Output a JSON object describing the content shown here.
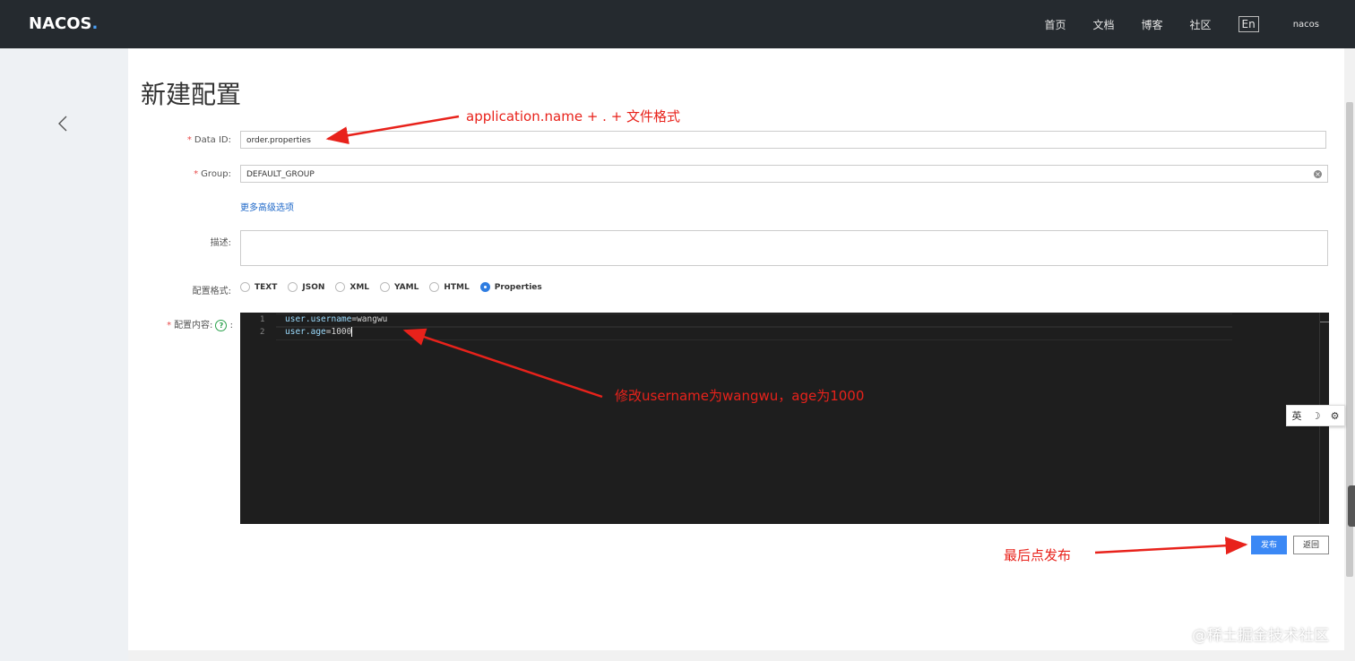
{
  "brand": {
    "name_left": "NA",
    "name_mid": "C",
    "name_right": "OS",
    "dot": "."
  },
  "nav": {
    "items": [
      "首页",
      "文档",
      "博客",
      "社区"
    ],
    "lang": "En",
    "user": "nacos"
  },
  "page": {
    "title": "新建配置"
  },
  "form": {
    "data_id": {
      "required": "*",
      "label": "Data ID:",
      "value": "order.properties"
    },
    "group": {
      "required": "*",
      "label": "Group:",
      "value": "DEFAULT_GROUP"
    },
    "more_link": "更多高级选项",
    "desc": {
      "label": "描述:"
    },
    "format": {
      "label": "配置格式:",
      "options": [
        "TEXT",
        "JSON",
        "XML",
        "YAML",
        "HTML",
        "Properties"
      ],
      "selected": "Properties"
    },
    "content": {
      "required": "*",
      "label": "配置内容:",
      "help": "?",
      "colon": ":",
      "line_numbers": [
        "1",
        "2"
      ],
      "lines": [
        {
          "key": "user.username",
          "value": "=wangwu"
        },
        {
          "key": "user.age",
          "value": "=1000"
        }
      ]
    }
  },
  "buttons": {
    "publish": "发布",
    "back": "返回"
  },
  "annotations": {
    "a1": "application.name + . + 文件格式",
    "a2": "修改username为wangwu，age为1000",
    "a3": "最后点发布"
  },
  "ime": {
    "c1": "英",
    "c2": "☽",
    "c3": "⚙"
  },
  "watermark": "@稀土掘金技术社区",
  "colors": {
    "topbar": "#252a2f",
    "primary": "#3b88f5",
    "annotation": "#e8221b",
    "editor_bg": "#1e1e1e"
  }
}
